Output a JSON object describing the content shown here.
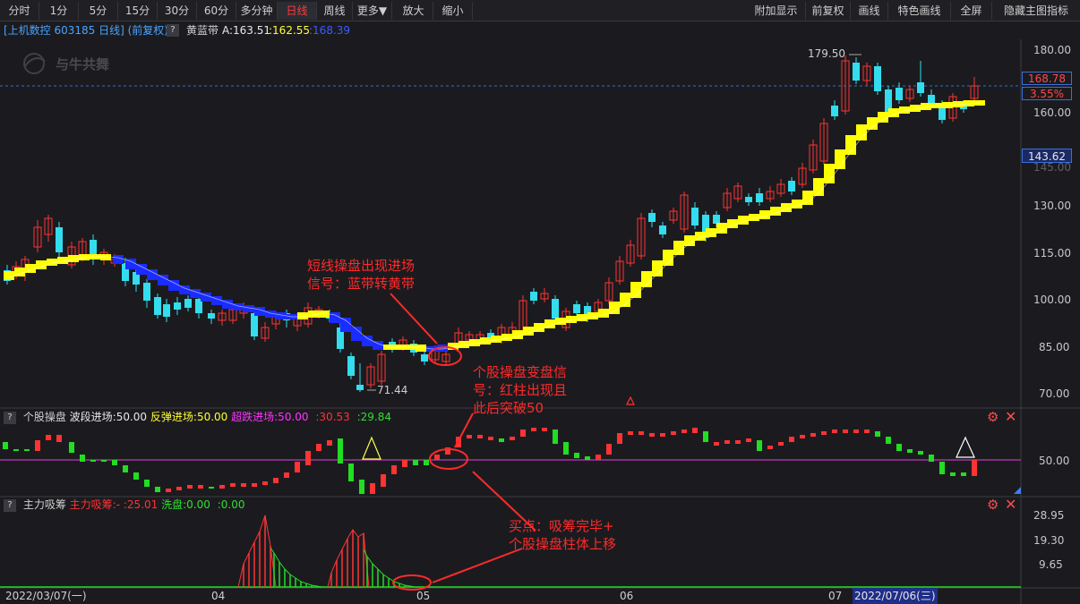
{
  "toolbar": {
    "left": [
      "分时",
      "1分",
      "5分",
      "15分",
      "30分",
      "60分",
      "多分钟",
      "日线",
      "周线",
      "更多▼",
      "放大",
      "缩小"
    ],
    "right": [
      "附加显示",
      "前复权",
      "画线",
      "特色画线",
      "全屏",
      "隐藏主图指标"
    ],
    "active": "日线"
  },
  "info": {
    "stock": "[上机数控 603185 日线] (前复权)",
    "indicator": "黄蓝带",
    "a_label": "A:163.51",
    "b_label": ":162.55",
    "c_label": ":168.39"
  },
  "main_axis": {
    "ticks": [
      "180.00",
      "160.00",
      "145.00",
      "130.00",
      "115.00",
      "100.00",
      "85.00",
      "70.00"
    ],
    "price_tag": "168.78",
    "pct_tag": "3.55%",
    "cursor_tag": "143.62"
  },
  "main_chart": {
    "high_label": "179.50",
    "low_label": "71.44",
    "watermark": "与牛共舞",
    "annot1_l1": "短线操盘出现进场",
    "annot1_l2": "信号：蓝带转黄带",
    "annot2_l1": "个股操盘变盘信",
    "annot2_l2": "号：红柱出现且",
    "annot2_l3": "此后突破50"
  },
  "panel1": {
    "name": "个股操盘",
    "p_a": "波段进场:50.00",
    "p_b": "反弹进场:50.00",
    "p_c": "超跌进场:50.00",
    "p_d": ":30.53",
    "p_e": ":29.84",
    "tick": "50.00"
  },
  "panel2": {
    "name": "主力吸筹",
    "p_a": "主力吸筹:-",
    "p_b": ":25.01",
    "p_c": "洗盘:0.00",
    "p_d": ":0.00",
    "ticks": [
      "28.95",
      "19.30",
      "9.65"
    ],
    "annot_l1": "买点：吸筹完毕+",
    "annot_l2": "个股操盘柱体上移"
  },
  "date_axis": {
    "start": "2022/03/07(一)",
    "m04": "04",
    "m05": "05",
    "m06": "06",
    "m07": "07",
    "cursor_date": "2022/07/06(三)"
  },
  "colors": {
    "up": "#ff3333",
    "down": "#33ddee",
    "yellow_band": "#ffff00",
    "blue_band": "#1a2cff",
    "magenta": "#e040e0",
    "green": "#22dd22",
    "annotation": "#ff2a2a",
    "dashed_price": "#2a6fd8"
  }
}
